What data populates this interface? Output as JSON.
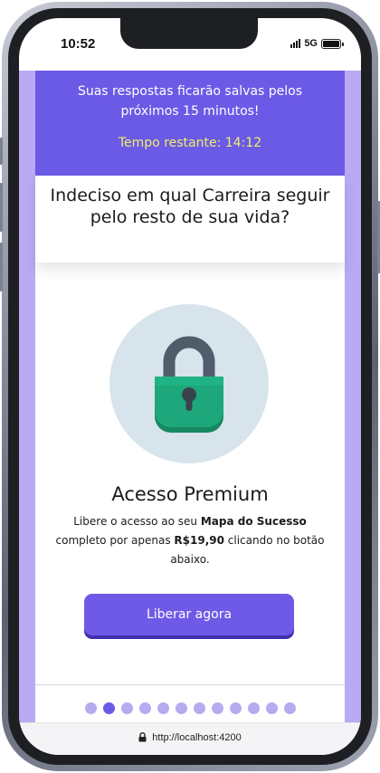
{
  "status_bar": {
    "time": "10:52",
    "network": "5G"
  },
  "banner": {
    "message": "Suas respostas ficarão salvas pelos próximos 15 minutos!",
    "timer": "Tempo restante: 14:12"
  },
  "headline": "Indeciso em qual Carreira seguir pelo resto de sua vida?",
  "premium": {
    "icon": "lock-icon",
    "title": "Acesso Premium",
    "desc_part1": "Libere o acesso ao seu ",
    "desc_bold1": "Mapa do Sucesso",
    "desc_part2": " completo por apenas ",
    "desc_bold2": "R$19,90",
    "desc_part3": " clicando no botão abaixo.",
    "button_label": "Liberar agora"
  },
  "pagination": {
    "total": 12,
    "current": 2
  },
  "browser": {
    "url": "http://localhost:4200"
  },
  "colors": {
    "primary": "#6b5ae6",
    "timer_text": "#eef06a",
    "lock_green": "#1ea77a",
    "lock_shackle": "#4f5d6b",
    "lock_background": "#d7e4ec"
  }
}
